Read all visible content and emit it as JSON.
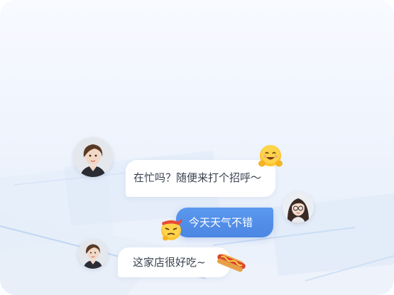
{
  "messages": [
    {
      "side": "left",
      "text": "在忙吗？随便来打个招呼～",
      "avatar": "woman-short-hair-avatar",
      "sticker": "hugging-face-emoji"
    },
    {
      "side": "right",
      "text": "今天天气不错",
      "avatar": "woman-glasses-long-hair-avatar",
      "sticker": "annoyed-face-emoji"
    },
    {
      "side": "left",
      "text": "这家店很好吃~",
      "avatar": "woman-short-hair-avatar",
      "sticker": "hot-dog-emoji"
    }
  ],
  "colors": {
    "outgoing_bubble": "#4b86e3",
    "incoming_bubble": "#ffffff",
    "incoming_text": "#3a4150",
    "background": "#eff4fd"
  }
}
